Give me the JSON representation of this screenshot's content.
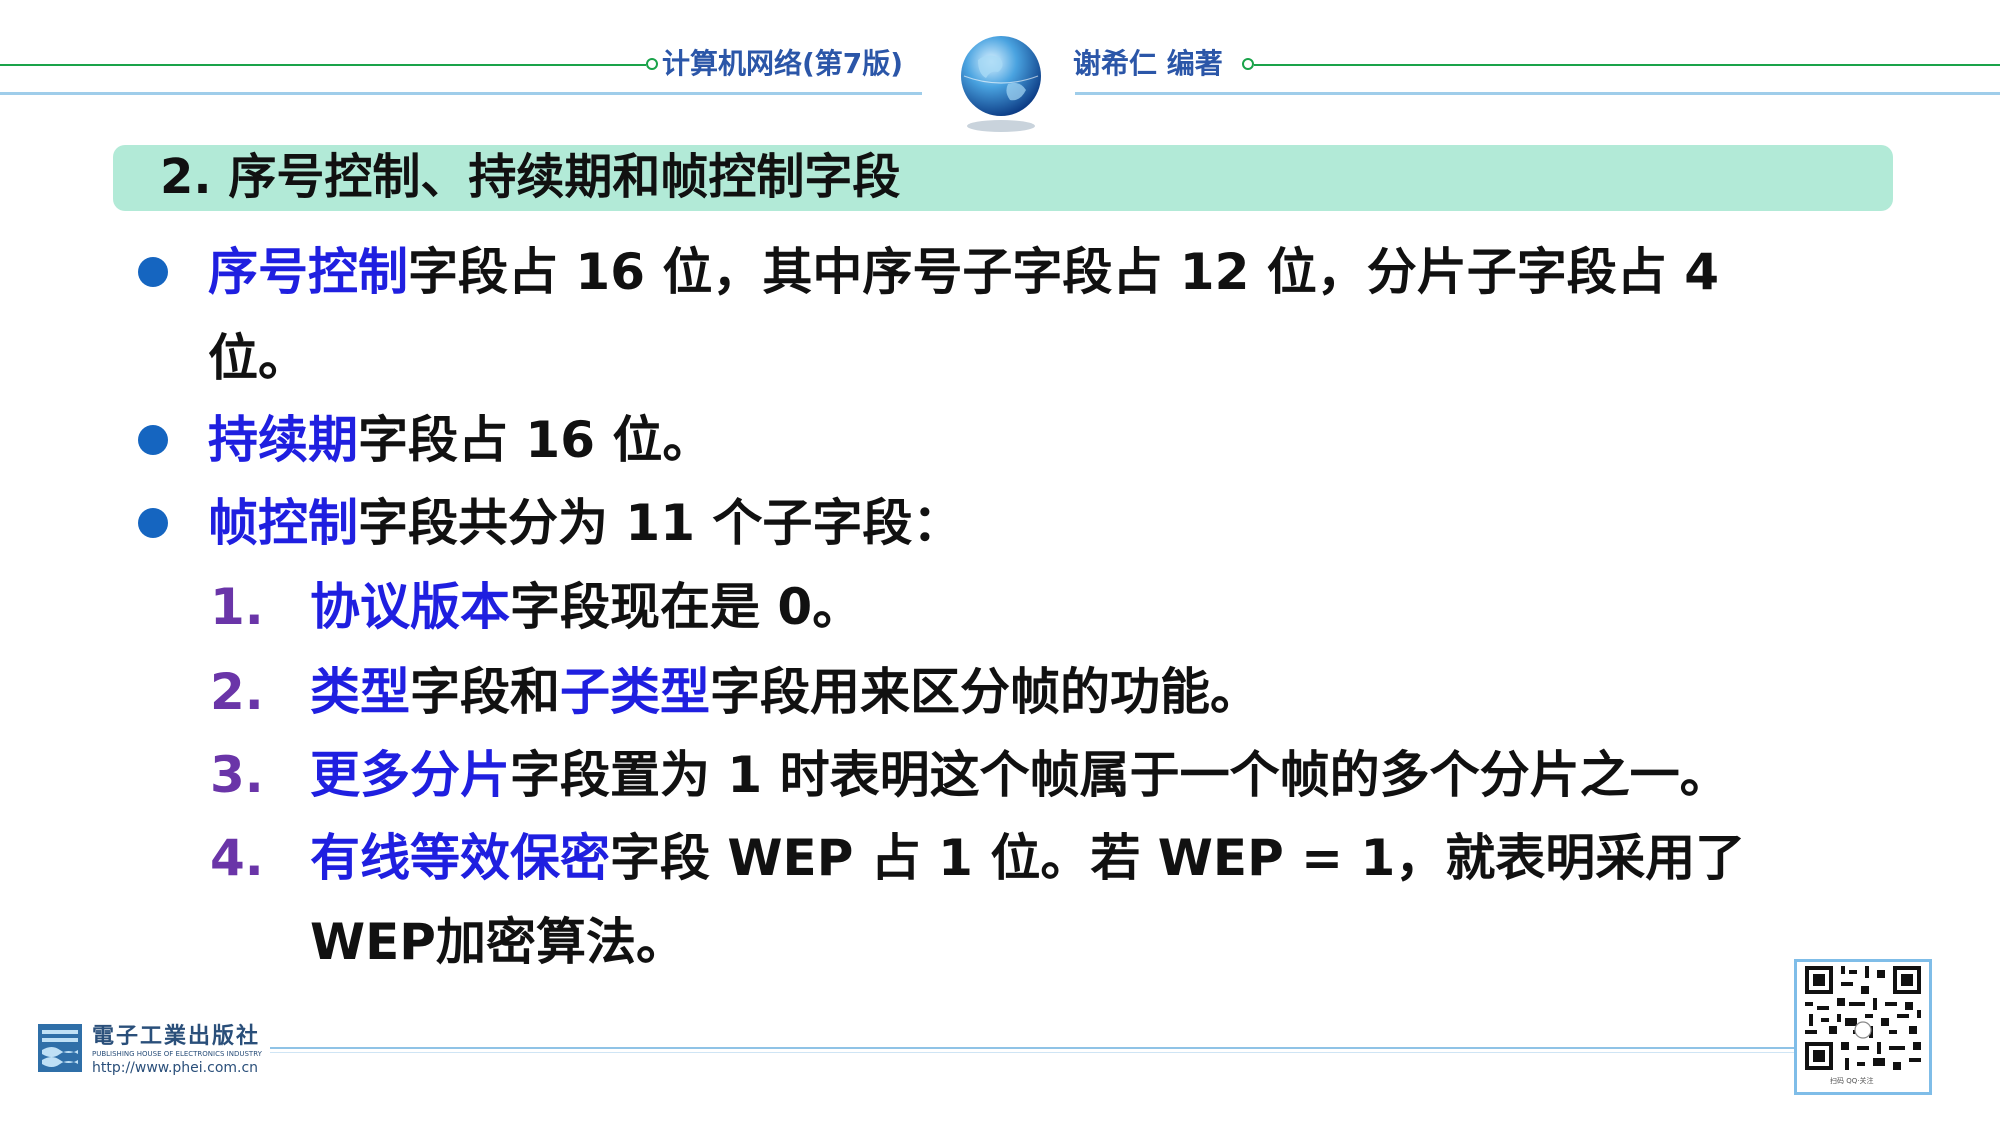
{
  "header": {
    "book_title": "计算机网络(第7版)",
    "author": "谢希仁 编著",
    "colors": {
      "line": "#1aa34a",
      "text": "#2b56a8",
      "subline": "#9fcdea"
    }
  },
  "title": "2. 序号控制、持续期和帧控制字段",
  "bullets": [
    {
      "keyword": "序号控制",
      "lines": [
        "字段占 16 位，其中序号子字段占 12 位，分片子字段占 4",
        "位。"
      ]
    },
    {
      "keyword": "持续期",
      "lines": [
        "字段占 16 位。"
      ]
    },
    {
      "keyword": "帧控制",
      "lines": [
        "字段共分为 11 个子字段："
      ]
    }
  ],
  "subitems": [
    {
      "number": "1.",
      "segments": [
        {
          "text": "协议版本",
          "kw": true
        },
        {
          "text": "字段现在是 0。",
          "kw": false
        }
      ]
    },
    {
      "number": "2.",
      "segments": [
        {
          "text": "类型",
          "kw": true
        },
        {
          "text": "字段和",
          "kw": false
        },
        {
          "text": "子类型",
          "kw": true
        },
        {
          "text": "字段用来区分帧的功能。",
          "kw": false
        }
      ]
    },
    {
      "number": "3.",
      "segments": [
        {
          "text": "更多分片",
          "kw": true
        },
        {
          "text": "字段置为 1 时表明这个帧属于一个帧的多个分片之一。",
          "kw": false
        }
      ]
    },
    {
      "number": "4.",
      "segments": [
        {
          "text": "有线等效保密",
          "kw": true
        },
        {
          "text": "字段 WEP 占 1 位。若 WEP = 1，就表明采用了",
          "kw": false
        }
      ],
      "continuation": "WEP加密算法。"
    }
  ],
  "footer": {
    "publisher": "電子工業出版社",
    "publisher_en": "PUBLISHING HOUSE OF ELECTRONICS INDUSTRY",
    "url": "http://www.phei.com.cn",
    "qr_caption": "扫码 QQ·关注"
  },
  "colors": {
    "keyword": "#1f1fe0",
    "number": "#6a35a8",
    "bullet": "#1565c0",
    "title_bar": "#b2ead7"
  }
}
